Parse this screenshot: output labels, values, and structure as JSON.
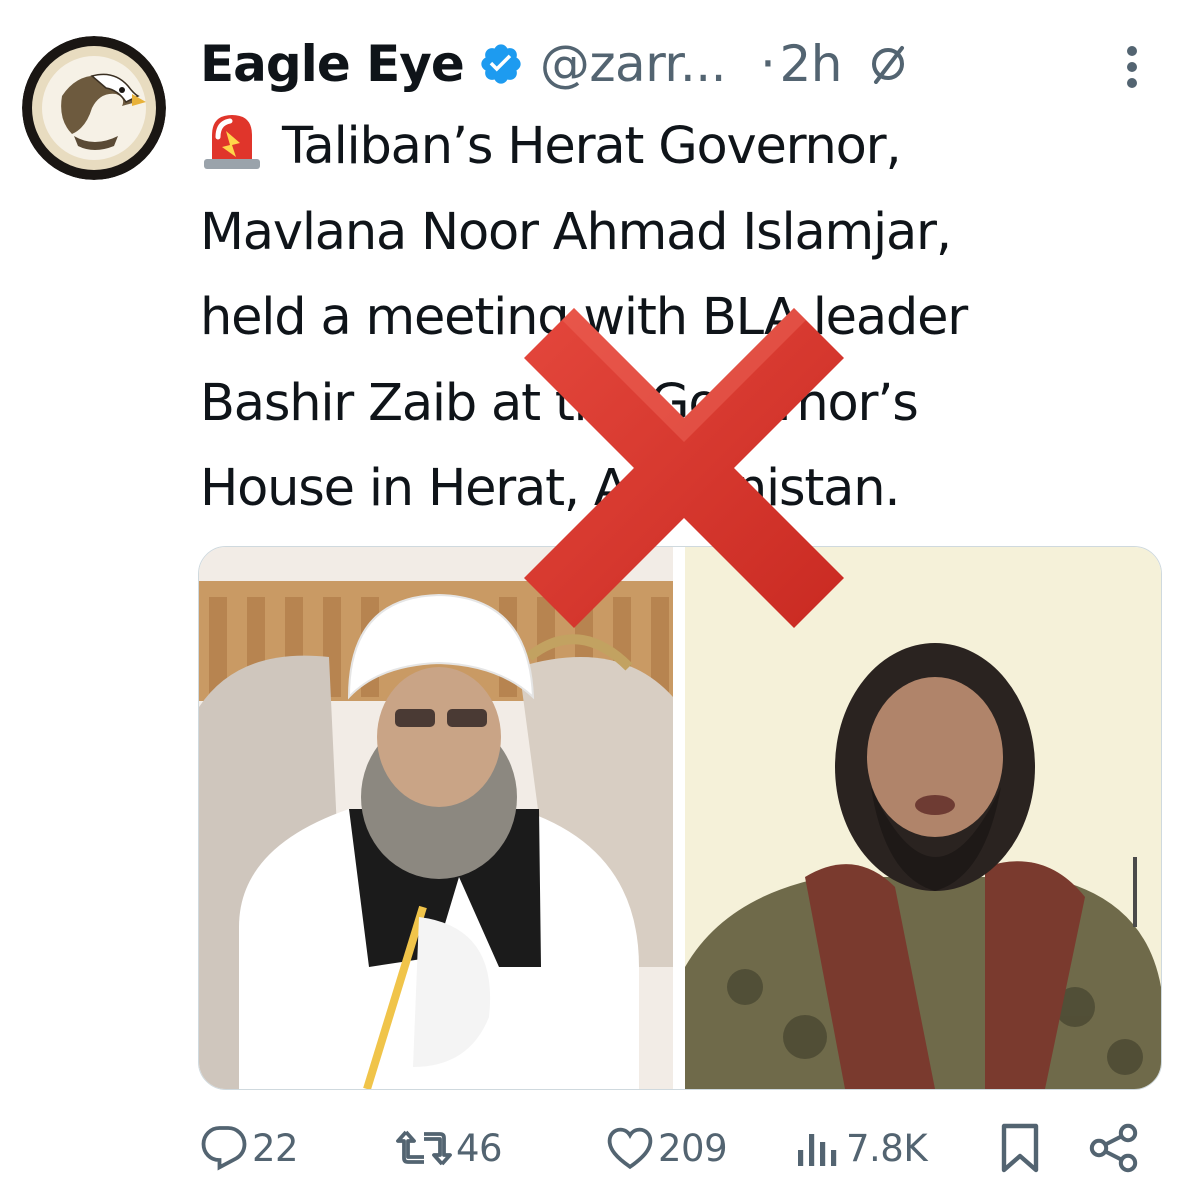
{
  "tweet": {
    "author": {
      "display_name": "Eagle Eye",
      "handle": "@zarr...",
      "verified": true,
      "avatar_icon": "eagle-emblem-avatar"
    },
    "separator": "·",
    "time": "2h",
    "text_lines": [
      "Taliban’s Herat Governor,",
      "Mavlana Noor Ahmad Islamjar,",
      "held a meeting with BLA leader",
      "Bashir Zaib at the Governor’s",
      "House in Herat, Afghanistan."
    ],
    "leading_emoji": "police-car-light-icon",
    "media": [
      {
        "icon": "photo-cleric-white-turban",
        "background": "#e9dcc8"
      },
      {
        "icon": "photo-bearded-man-camouflage",
        "background": "#f3efd2"
      }
    ],
    "overlay": {
      "icon": "red-x-mark",
      "color": "#d8342c"
    },
    "actions": {
      "replies": "22",
      "reposts": "46",
      "likes": "209",
      "views": "7.8K"
    }
  },
  "colors": {
    "text_primary": "#0f1419",
    "text_secondary": "#536471",
    "verified_blue": "#1d9bf0",
    "border": "#cfd9de"
  }
}
